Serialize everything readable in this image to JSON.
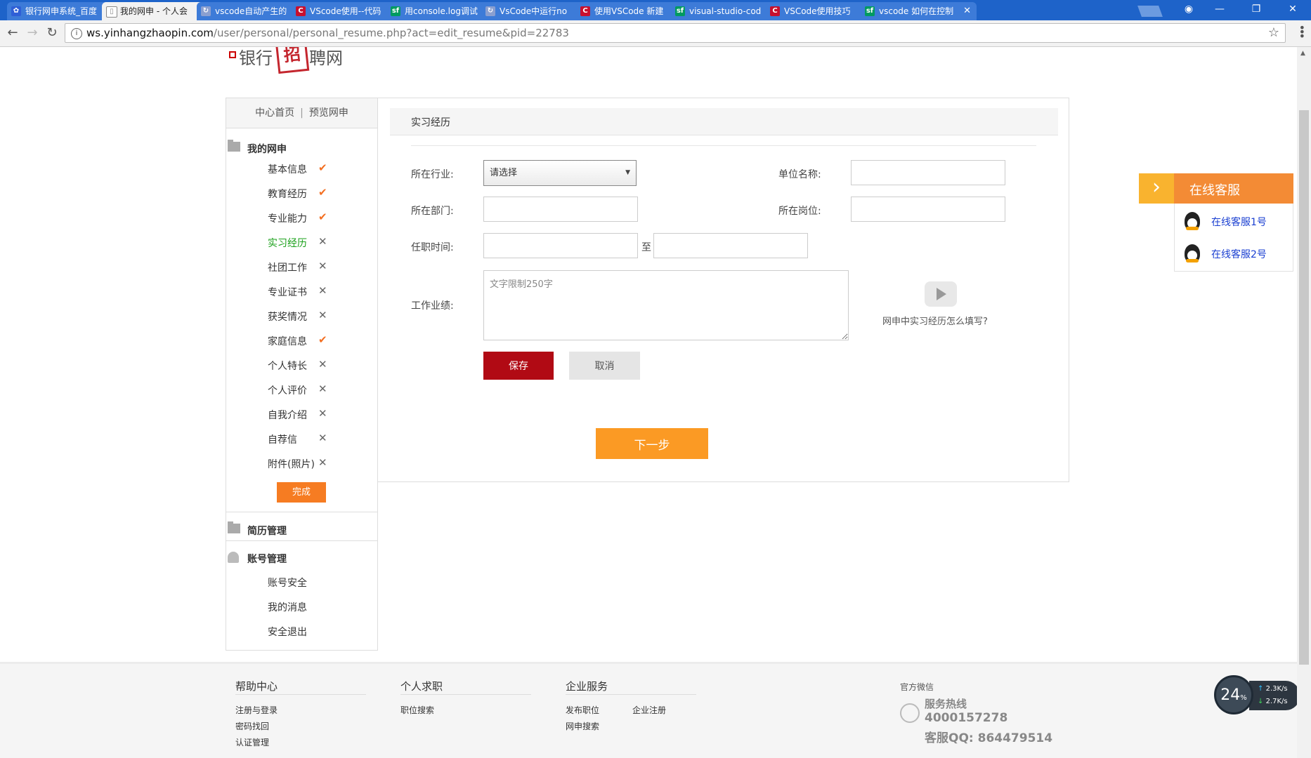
{
  "browser": {
    "tabs": [
      {
        "label": "银行网申系统_百度",
        "icon": "baidu-paw",
        "icon_color": "#2f5fd6",
        "active": false
      },
      {
        "label": "我的网申 - 个人会",
        "icon": "page-doc",
        "icon_color": "#666666",
        "active": true
      },
      {
        "label": "vscode自动产生的",
        "icon": "search-loop",
        "icon_color": "#8a9fd0",
        "active": false
      },
      {
        "label": "VScode使用--代码",
        "icon": "csdn-c",
        "icon_color": "#c8102e",
        "active": false
      },
      {
        "label": "用console.log调试",
        "icon": "sf-logo",
        "icon_color": "#009a61",
        "active": false
      },
      {
        "label": "VsCode中运行no",
        "icon": "search-loop",
        "icon_color": "#8a9fd0",
        "active": false
      },
      {
        "label": "使用VSCode 新建",
        "icon": "csdn-c",
        "icon_color": "#c8102e",
        "active": false
      },
      {
        "label": "visual-studio-cod",
        "icon": "sf-logo",
        "icon_color": "#009a61",
        "active": false
      },
      {
        "label": "VSCode使用技巧",
        "icon": "csdn-c",
        "icon_color": "#c8102e",
        "active": false
      },
      {
        "label": "vscode 如何在控制",
        "icon": "sf-logo",
        "icon_color": "#009a61",
        "active": false
      }
    ],
    "url_host": "ws.yinhangzhaopin.com",
    "url_path": "/user/personal/personal_resume.php?act=edit_resume&pid=22783"
  },
  "logo": {
    "part1": "银行",
    "mark": "招",
    "part2": "聘网"
  },
  "sidebar": {
    "top_links": [
      "中心首页",
      "预览网申"
    ],
    "section_my": "我的网申",
    "items": [
      {
        "label": "基本信息",
        "status": "done"
      },
      {
        "label": "教育经历",
        "status": "done"
      },
      {
        "label": "专业能力",
        "status": "done"
      },
      {
        "label": "实习经历",
        "status": "todo"
      },
      {
        "label": "社团工作",
        "status": "todo"
      },
      {
        "label": "专业证书",
        "status": "todo"
      },
      {
        "label": "获奖情况",
        "status": "todo"
      },
      {
        "label": "家庭信息",
        "status": "done"
      },
      {
        "label": "个人特长",
        "status": "todo"
      },
      {
        "label": "个人评价",
        "status": "todo"
      },
      {
        "label": "自我介绍",
        "status": "todo"
      },
      {
        "label": "自荐信",
        "status": "todo"
      },
      {
        "label": "附件(照片)",
        "status": "todo"
      }
    ],
    "done_label": "完成",
    "section_resume": "简历管理",
    "section_account": "账号管理",
    "account_items": [
      "账号安全",
      "我的消息",
      "安全退出"
    ],
    "check_mark": "✔",
    "cross_mark": "✕"
  },
  "form": {
    "title": "实习经历",
    "industry_label": "所在行业:",
    "industry_value": "请选择",
    "company_label": "单位名称:",
    "company_value": "",
    "department_label": "所在部门:",
    "department_value": "",
    "position_label": "所在岗位:",
    "position_value": "",
    "period_label": "任职时间:",
    "start_value": "",
    "to_label": "至",
    "end_value": "",
    "achievement_label": "工作业绩:",
    "achievement_placeholder": "文字限制250字",
    "help_text": "网申中实习经历怎么填写?",
    "save_label": "保存",
    "cancel_label": "取消",
    "next_label": "下一步"
  },
  "customer_service": {
    "title": "在线客服",
    "arrow": "›",
    "items": [
      "在线客服1号",
      "在线客服2号"
    ]
  },
  "footer": {
    "help_title": "帮助中心",
    "help_links": [
      "注册与登录",
      "密码找回",
      "认证管理"
    ],
    "job_title": "个人求职",
    "job_links": [
      "职位搜索"
    ],
    "ent_title": "企业服务",
    "ent_links": [
      "发布职位",
      "企业注册",
      "网申搜索"
    ],
    "wechat_title": "官方微信",
    "hotline_label": "服务热线",
    "hotline_number": "4000157278",
    "qq_line": "客服QQ: 864479514"
  },
  "speed_widget": {
    "percent": "24",
    "percent_sign": "%",
    "up": "2.3K/s",
    "down": "2.7K/s"
  },
  "colors": {
    "save": "#b10a14",
    "next": "#fb9a24",
    "done_button": "#f67c22",
    "check": "#f36f22",
    "current_item": "#1aa01a",
    "cs_header": "#f38b35",
    "tabbar": "#1e63c9"
  }
}
